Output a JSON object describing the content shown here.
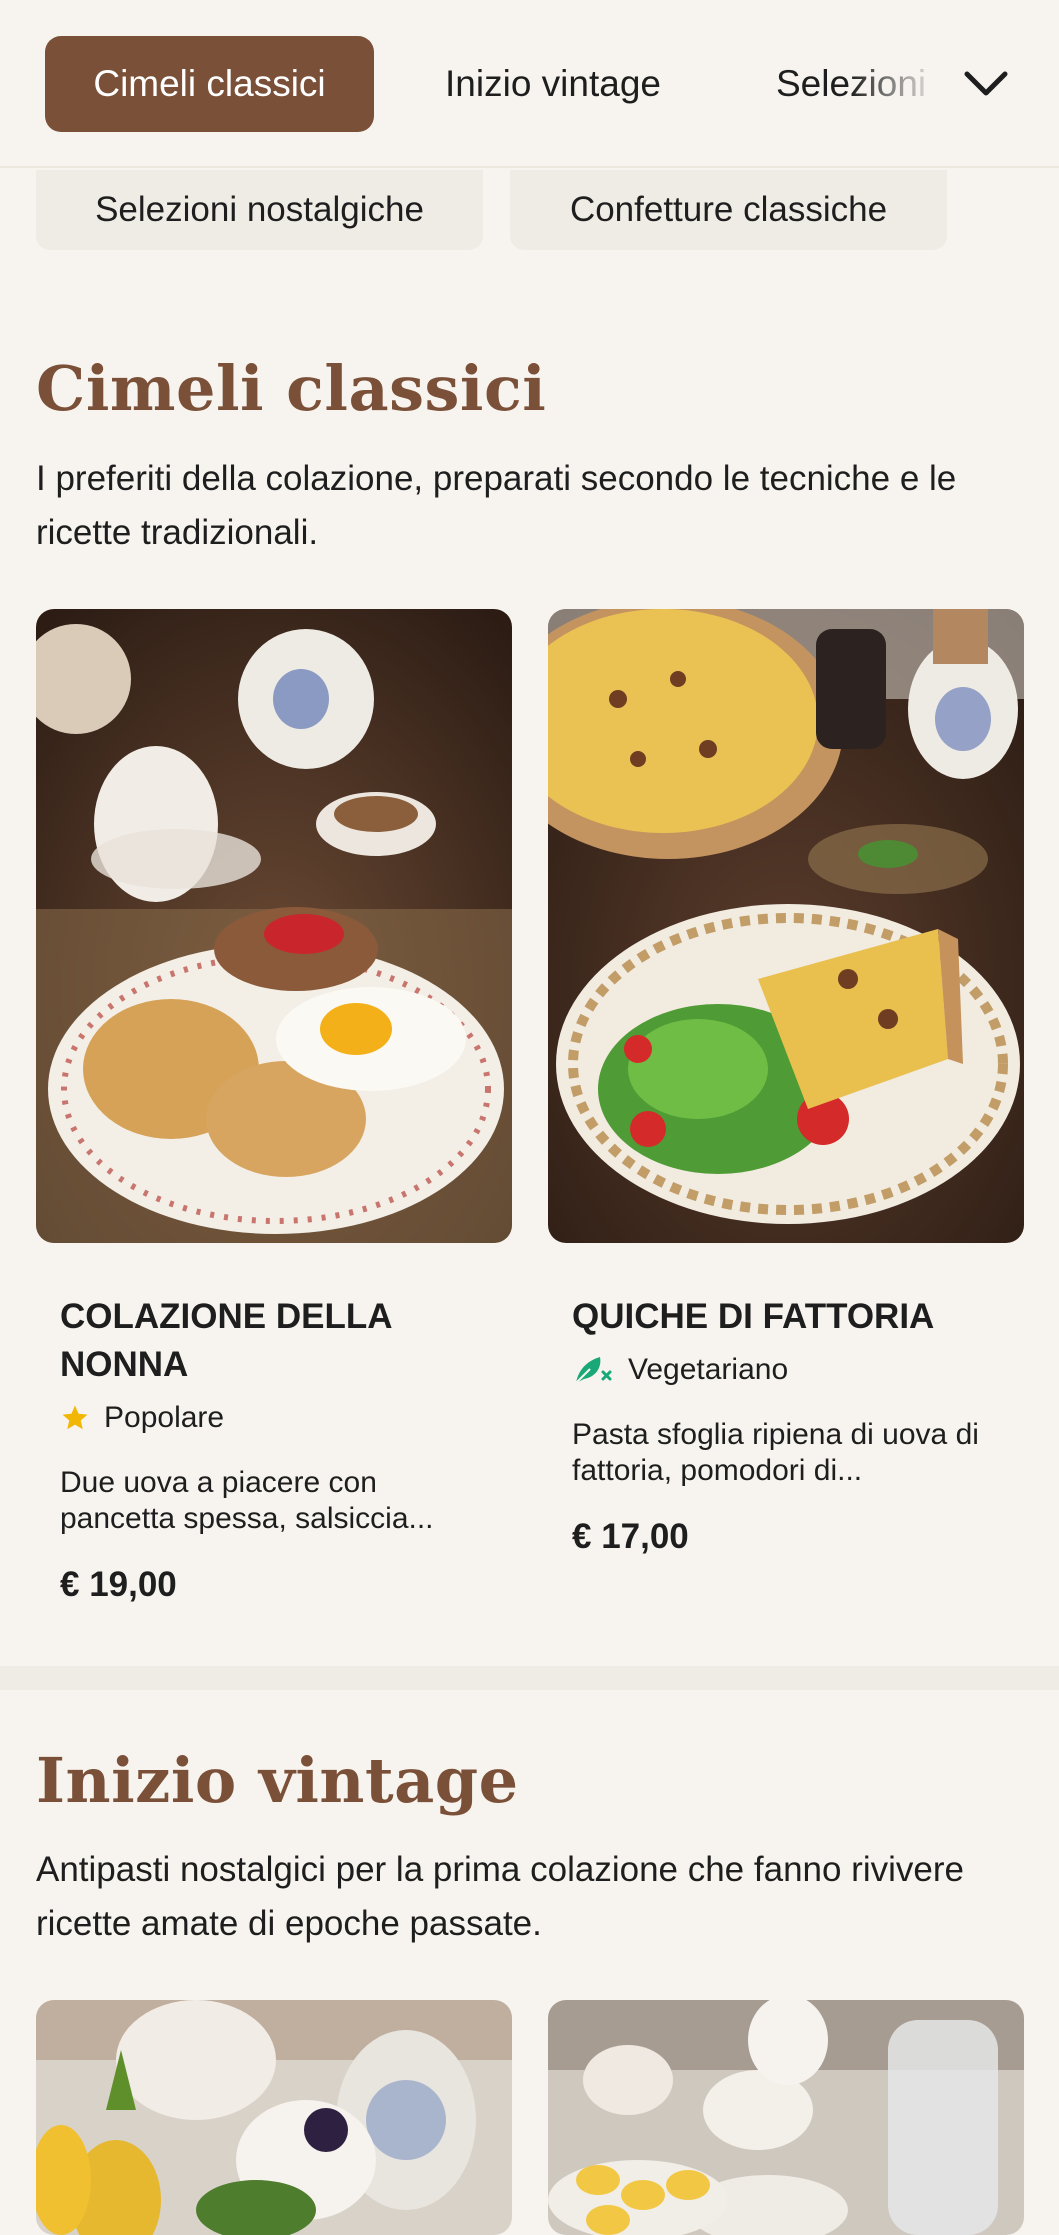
{
  "nav": {
    "tabs": [
      {
        "label": "Cimeli classici",
        "active": true
      },
      {
        "label": "Inizio vintage",
        "active": false
      },
      {
        "label": "Selezioni",
        "active": false
      }
    ],
    "chips": [
      {
        "label": "Selezioni nostalgiche"
      },
      {
        "label": "Confetture classiche"
      }
    ],
    "more_icon": "chevron-down-icon"
  },
  "colors": {
    "accent": "#7b5038",
    "background": "#f7f4ef",
    "chip_bg": "#efebe5",
    "star": "#f2b705",
    "veg": "#1aa878"
  },
  "sections": [
    {
      "title": "Cimeli classici",
      "description": "I preferiti della colazione, preparati secondo le tecniche e le ricette tradizionali.",
      "items": [
        {
          "title": "COLAZIONE DELLA NONNA",
          "badge": "Popolare",
          "badge_icon": "star-icon",
          "description": "Due uova a piacere con pancetta spessa, salsiccia...",
          "price": "€ 19,00"
        },
        {
          "title": "QUICHE DI FATTORIA",
          "badge": "Vegetariano",
          "badge_icon": "leaf-icon",
          "description": "Pasta sfoglia ripiena di uova di fattoria, pomodori di...",
          "price": "€ 17,00"
        }
      ]
    },
    {
      "title": "Inizio vintage",
      "description": "Antipasti nostalgici per la prima colazione che fanno rivivere ricette amate di epoche passate."
    }
  ]
}
